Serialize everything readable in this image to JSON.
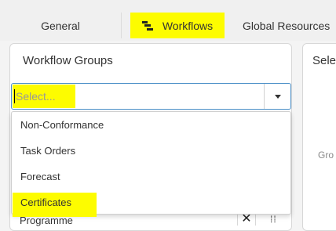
{
  "tabs": [
    {
      "label": "General",
      "active": false,
      "icon": ""
    },
    {
      "label": "Workflows",
      "active": true,
      "icon": "workflow-icon"
    },
    {
      "label": "Global Resources",
      "active": false,
      "icon": ""
    }
  ],
  "workflow_groups": {
    "title": "Workflow Groups",
    "select": {
      "value": "",
      "placeholder": "Select..."
    },
    "options": [
      "Non-Conformance",
      "Task Orders",
      "Forecast",
      "Certificates"
    ],
    "row_behind": {
      "label": "Programme",
      "remove_glyph": "✕",
      "drag_glyph": "⁞⁞"
    }
  },
  "right_panel": {
    "title": "Sele",
    "hint": "Gro"
  },
  "colors": {
    "highlight": "#fdfc00",
    "focus_border": "#4d90c8"
  }
}
